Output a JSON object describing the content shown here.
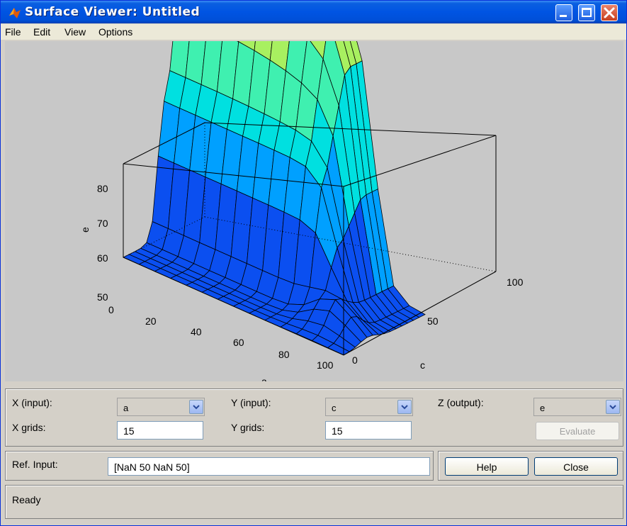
{
  "window": {
    "title": "Surface Viewer: Untitled"
  },
  "menu": {
    "items": [
      "File",
      "Edit",
      "View",
      "Options"
    ]
  },
  "plot": {
    "z_axis_label": "e",
    "x_axis_label": "a",
    "y_axis_label": "c",
    "z_ticks": [
      "80",
      "70",
      "60",
      "50"
    ],
    "x_ticks": [
      "0",
      "20",
      "40",
      "60",
      "80",
      "100"
    ],
    "y_ticks": [
      "0",
      "50",
      "100"
    ],
    "colormap": [
      "#0b4ff0",
      "#00a0ff",
      "#00e0e0",
      "#3ff0b0",
      "#a8f060",
      "#ffff00"
    ]
  },
  "controls": {
    "x_input_label": "X (input):",
    "x_input_value": "a",
    "y_input_label": "Y (input):",
    "y_input_value": "c",
    "z_output_label": "Z (output):",
    "z_output_value": "e",
    "x_grids_label": "X grids:",
    "x_grids_value": "15",
    "y_grids_label": "Y grids:",
    "y_grids_value": "15",
    "evaluate_label": "Evaluate",
    "ref_input_label": "Ref. Input:",
    "ref_input_value": "[NaN 50 NaN 50]",
    "help_label": "Help",
    "close_label": "Close"
  },
  "status": {
    "text": "Ready"
  }
}
